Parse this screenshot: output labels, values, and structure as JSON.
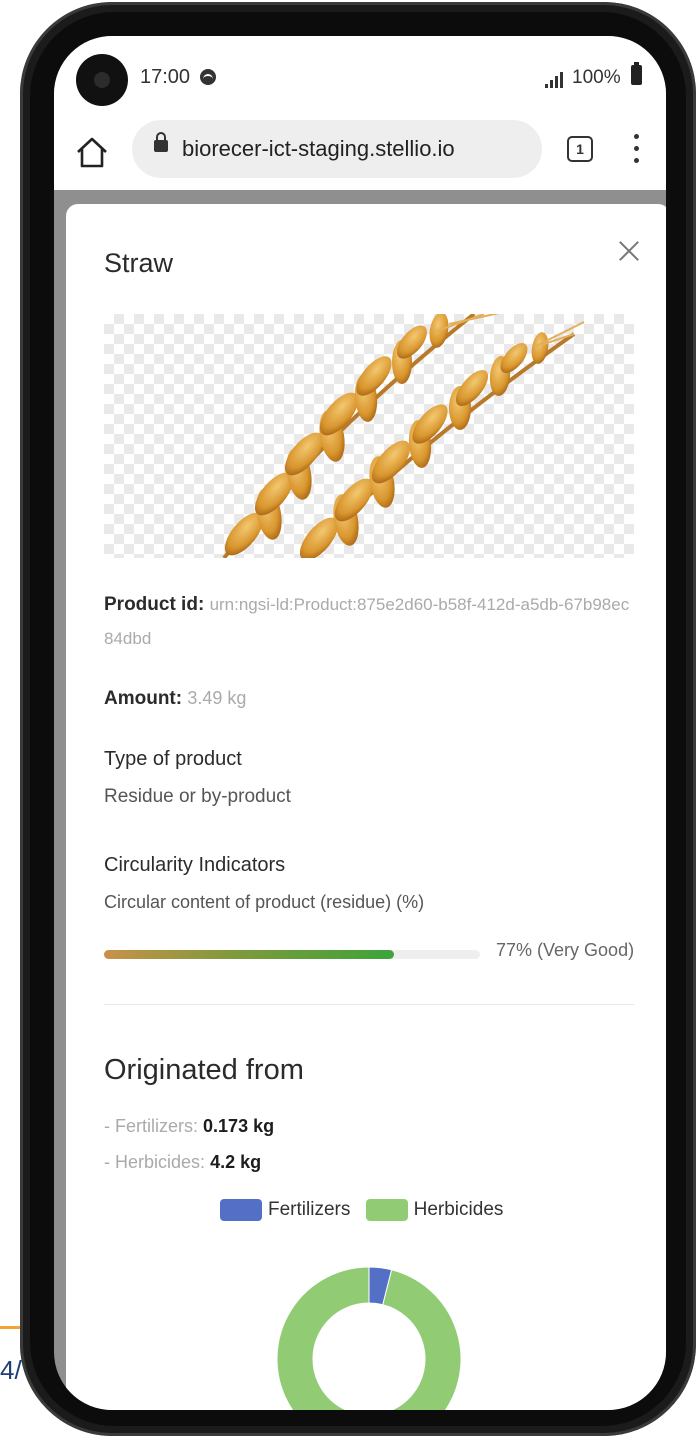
{
  "status_bar": {
    "time": "17:00",
    "battery": "100%"
  },
  "browser": {
    "url": "biorecer-ict-staging.stellio.io",
    "tab_count": "1"
  },
  "modal": {
    "title": "Straw",
    "product_id_label": "Product id:",
    "product_id_value": "urn:ngsi-ld:Product:875e2d60-b58f-412d-a5db-67b98ec84dbd",
    "amount_label": "Amount:",
    "amount_value": "3.49 kg",
    "type_label": "Type of product",
    "type_value": "Residue or by-product",
    "circularity_label": "Circularity Indicators",
    "circularity_sub": "Circular content of product (residue) (%)",
    "circularity_percent": 77,
    "circularity_text": "77% (Very Good)",
    "origin_title": "Originated from",
    "origins": [
      {
        "prefix": "- ",
        "label": "Fertilizers:",
        "value": "0.173 kg"
      },
      {
        "prefix": "- ",
        "label": "Herbicides:",
        "value": "4.2 kg"
      }
    ]
  },
  "chart_data": {
    "type": "pie",
    "categories": [
      "Fertilizers",
      "Herbicides"
    ],
    "values": [
      0.173,
      4.2
    ],
    "colors": [
      "#5470c6",
      "#91cc75"
    ],
    "legend": "top"
  },
  "slide": {
    "page_number": "4/"
  },
  "colors": {
    "fertilizers": "#5470c6",
    "herbicides": "#91cc75",
    "slide_accent": "#f2a530"
  }
}
